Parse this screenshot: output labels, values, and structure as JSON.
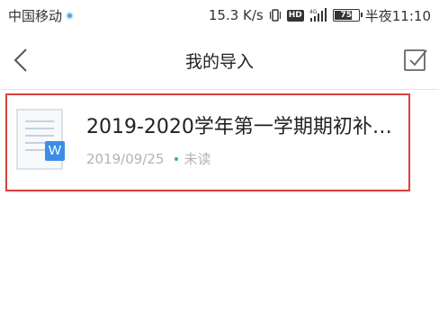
{
  "status_bar": {
    "carrier": "中国移动",
    "speed": "15.3 K/s",
    "hd": "HD",
    "network": "4G",
    "battery": "75",
    "battery_level": 0.75,
    "time": "半夜11:10"
  },
  "nav": {
    "title": "我的导入",
    "back_icon": "chevron-left-icon",
    "select_icon": "checkbox-icon"
  },
  "documents": [
    {
      "title": "2019-2020学年第一学期期初补…",
      "date": "2019/09/25",
      "status": "未读",
      "badge": "W",
      "status_color": "#3ab27a"
    }
  ],
  "colors": {
    "highlight": "#d9423f",
    "word_badge": "#3a8ee6"
  }
}
